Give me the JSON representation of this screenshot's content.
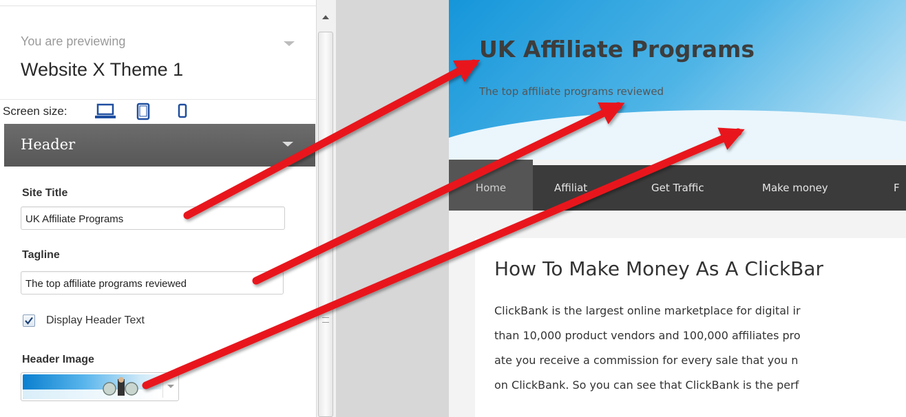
{
  "customizer": {
    "preview_label": "You are previewing",
    "theme_name": "Website X Theme 1",
    "screen_size_label": "Screen size:",
    "devices": [
      "desktop-icon",
      "tablet-icon",
      "mobile-icon"
    ],
    "section_title": "Header",
    "site_title_label": "Site Title",
    "site_title_value": "UK Affiliate Programs",
    "tagline_label": "Tagline",
    "tagline_value": "The top affiliate programs reviewed",
    "display_header_text_label": "Display Header Text",
    "display_header_text_checked": true,
    "header_image_label": "Header Image"
  },
  "preview": {
    "site_title": "UK Affiliate Programs",
    "tagline": "The top affiliate programs reviewed",
    "nav": [
      "Home",
      "Affiliat",
      "Get Traffic",
      "Make money",
      "F"
    ],
    "post_title": "How To Make Money As A ClickBar",
    "post_lines": [
      "ClickBank is the largest online marketplace for digital ir",
      "than 10,000 product vendors and 100,000 affiliates pro",
      "ate you receive a commission for every sale that you n",
      "on ClickBank. So you can see that ClickBank is the perf"
    ]
  },
  "colors": {
    "arrow": "#e8121a",
    "header_bar": "#5f5f5f",
    "nav_bar": "#3b3b3b",
    "device_icon": "#1f4fa0"
  }
}
